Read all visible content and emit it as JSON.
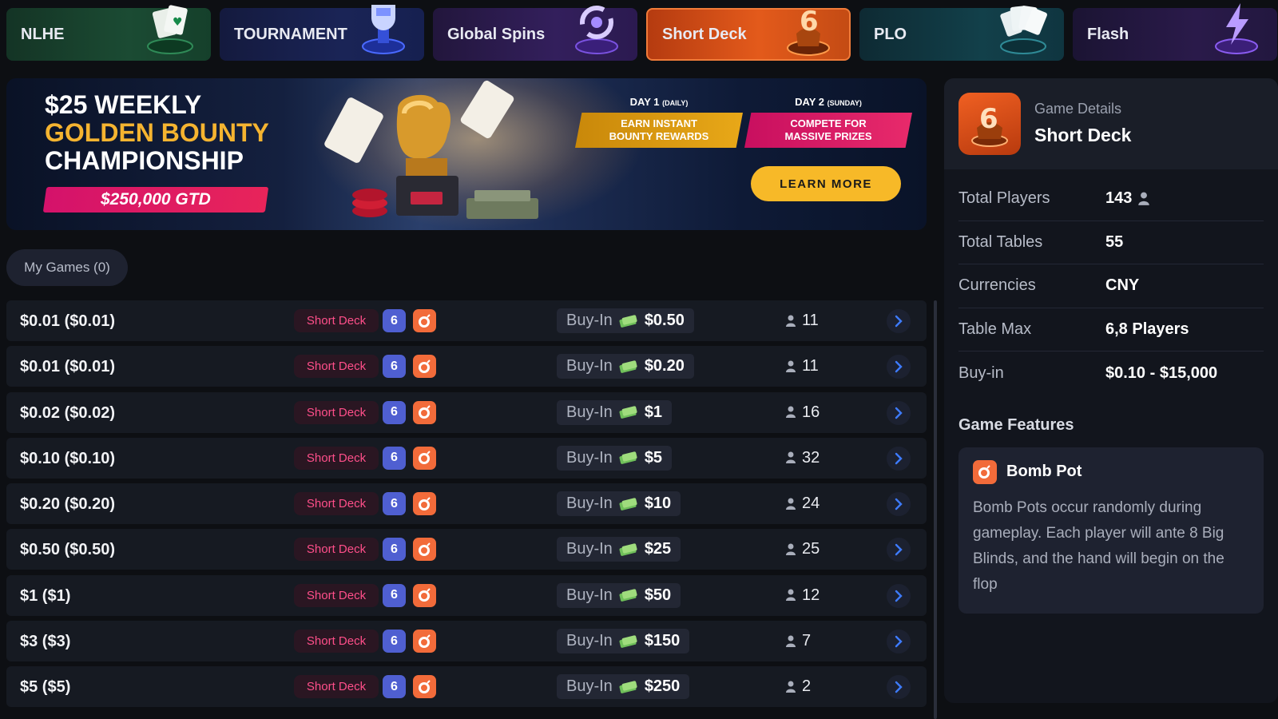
{
  "tabs": [
    {
      "label": "NLHE"
    },
    {
      "label": "TOURNAMENT"
    },
    {
      "label": "Global Spins"
    },
    {
      "label": "Short Deck"
    },
    {
      "label": "PLO"
    },
    {
      "label": "Flash"
    }
  ],
  "banner": {
    "line1": "$25 WEEKLY",
    "line2": "GOLDEN BOUNTY",
    "line3": "CHAMPIONSHIP",
    "gtd": "$250,000 GTD",
    "day1_title": "DAY 1",
    "day1_sub": "(DAILY)",
    "day1_text_a": "EARN INSTANT",
    "day1_text_b": "BOUNTY REWARDS",
    "day2_title": "DAY 2",
    "day2_sub": "(SUNDAY)",
    "day2_text_a": "COMPETE FOR",
    "day2_text_b": "MASSIVE PRIZES",
    "cta": "LEARN MORE"
  },
  "my_games": "My Games  (0)",
  "games": [
    {
      "stakes": "$0.01 ($0.01)",
      "variant": "Short Deck",
      "seats": "6",
      "buyin_label": "Buy-In",
      "buyin": "$0.50",
      "players": "11"
    },
    {
      "stakes": "$0.01 ($0.01)",
      "variant": "Short Deck",
      "seats": "6",
      "buyin_label": "Buy-In",
      "buyin": "$0.20",
      "players": "11"
    },
    {
      "stakes": "$0.02 ($0.02)",
      "variant": "Short Deck",
      "seats": "6",
      "buyin_label": "Buy-In",
      "buyin": "$1",
      "players": "16"
    },
    {
      "stakes": "$0.10 ($0.10)",
      "variant": "Short Deck",
      "seats": "6",
      "buyin_label": "Buy-In",
      "buyin": "$5",
      "players": "32"
    },
    {
      "stakes": "$0.20 ($0.20)",
      "variant": "Short Deck",
      "seats": "6",
      "buyin_label": "Buy-In",
      "buyin": "$10",
      "players": "24"
    },
    {
      "stakes": "$0.50 ($0.50)",
      "variant": "Short Deck",
      "seats": "6",
      "buyin_label": "Buy-In",
      "buyin": "$25",
      "players": "25"
    },
    {
      "stakes": "$1 ($1)",
      "variant": "Short Deck",
      "seats": "6",
      "buyin_label": "Buy-In",
      "buyin": "$50",
      "players": "12"
    },
    {
      "stakes": "$3 ($3)",
      "variant": "Short Deck",
      "seats": "6",
      "buyin_label": "Buy-In",
      "buyin": "$150",
      "players": "7"
    },
    {
      "stakes": "$5 ($5)",
      "variant": "Short Deck",
      "seats": "6",
      "buyin_label": "Buy-In",
      "buyin": "$250",
      "players": "2"
    }
  ],
  "details": {
    "subtitle": "Game Details",
    "title": "Short Deck",
    "rows": [
      {
        "key": "Total Players",
        "value": "143"
      },
      {
        "key": "Total Tables",
        "value": "55"
      },
      {
        "key": "Currencies",
        "value": "CNY"
      },
      {
        "key": "Table Max",
        "value": "6,8 Players"
      },
      {
        "key": "Buy-in",
        "value": "$0.10 - $15,000"
      }
    ],
    "features_title": "Game Features",
    "feature_name": "Bomb Pot",
    "feature_desc": "Bomb Pots occur randomly during gameplay. Each player will ante 8 Big Blinds, and the hand will begin on the flop"
  },
  "colors": {
    "accent_orange": "#e35a1b",
    "variant_pink": "#ff4f8a",
    "seat_blue": "#4f5fd1",
    "cta_yellow": "#f7b928",
    "chevron_blue": "#3d7bff"
  },
  "icons": [
    "cards-icon",
    "trophy-icon",
    "spin-icon",
    "short-deck-6-icon",
    "flash-icon",
    "bomb-icon",
    "cash-icon",
    "person-icon",
    "chevron-right-icon"
  ]
}
